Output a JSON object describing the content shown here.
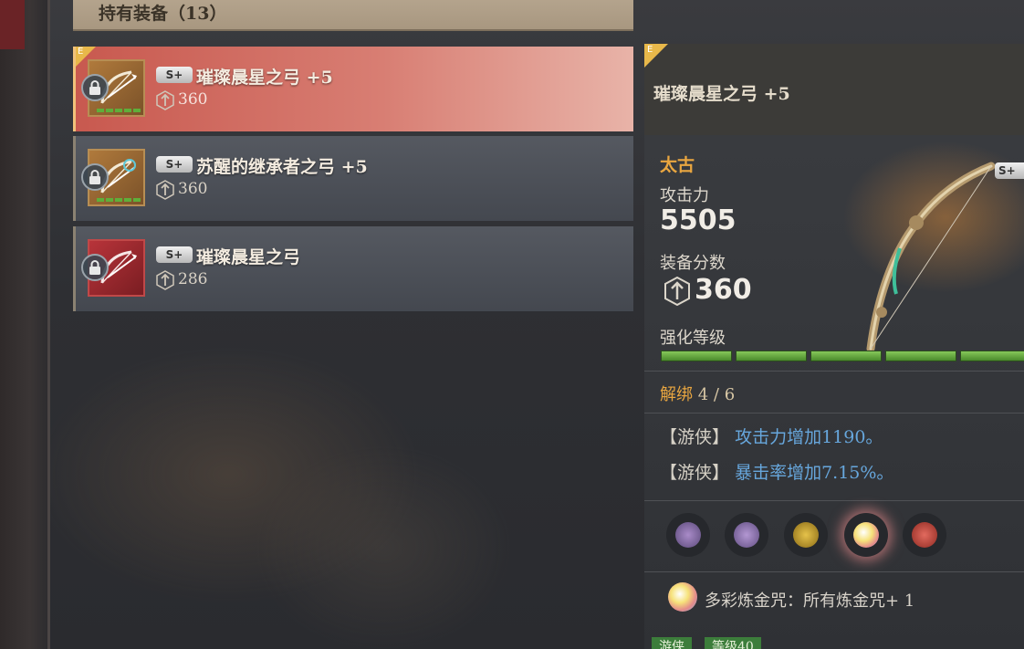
{
  "inventory": {
    "header_title": "持有装备（13）",
    "items": [
      {
        "tier": "E",
        "grade": "S+",
        "name": "璀璨晨星之弓 +5",
        "score": "360",
        "locked": true,
        "selected": true
      },
      {
        "tier": "",
        "grade": "S+",
        "name": "苏醒的继承者之弓 +5",
        "score": "360",
        "locked": true,
        "selected": false
      },
      {
        "tier": "",
        "grade": "S+",
        "name": "璀璨晨星之弓",
        "score": "286",
        "locked": true,
        "selected": false
      }
    ]
  },
  "detail": {
    "tier": "E",
    "name": "璀璨晨星之弓 +5",
    "era": "太古",
    "attack_label": "攻击力",
    "attack_value": "5505",
    "score_label": "装备分数",
    "score_value": "360",
    "enhance_label": "强化等级",
    "grade": "S+",
    "unbind_label": "解绑",
    "unbind_value": "4 / 6",
    "stats": [
      {
        "tag": "【游侠】",
        "text": "攻击力增加1190。"
      },
      {
        "tag": "【游侠】",
        "text": "暴击率增加7.15%。"
      }
    ],
    "runes": [
      "purple-arrow-rune-icon",
      "purple-arrow-rune-icon",
      "gold-rune-icon",
      "rainbow-orb-rune-icon",
      "red-rune-icon"
    ],
    "alchemy_text": "多彩炼金咒：所有炼金咒+ 1",
    "bottom_tags": [
      "游侠",
      "等级40"
    ]
  },
  "colors": {
    "selected_row": "#c8594f",
    "accent_gold": "#e9a640",
    "stat_blue": "#67a7dd",
    "enhance_green": "#5fae3a"
  }
}
